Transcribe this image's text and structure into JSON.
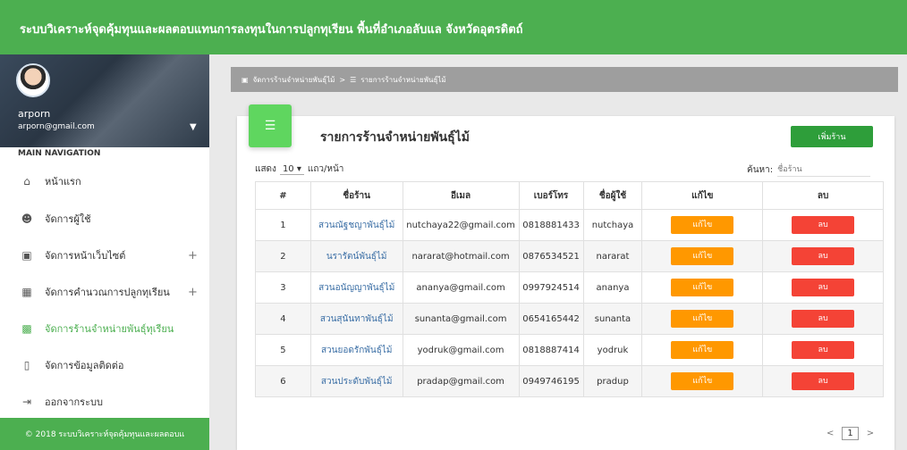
{
  "app": {
    "title": "ระบบวิเคราะห์จุดคุ้มทุนและผลตอบแทนการลงทุนในการปลูกทุเรียน พื้นที่อำเภอลับแล จังหวัดอุตรดิตถ์",
    "brand_color": "#4caf50"
  },
  "sidebar": {
    "user_name": "arporn",
    "user_email": "arporn@gmail.com",
    "nav_header": "MAIN NAVIGATION",
    "items": [
      {
        "label": "หน้าแรก",
        "icon": "home-icon"
      },
      {
        "label": "จัดการผู้ใช้",
        "icon": "user-icon"
      },
      {
        "label": "จัดการหน้าเว็บไซต์",
        "icon": "web-icon",
        "expand": "+"
      },
      {
        "label": "จัดการคำนวณการปลูกทุเรียน",
        "icon": "chart-icon",
        "expand": "+"
      },
      {
        "label": "จัดการร้านจำหน่ายพันธุ์ทุเรียน",
        "icon": "store-icon"
      },
      {
        "label": "จัดการข้อมูลติดต่อ",
        "icon": "message-icon"
      },
      {
        "label": "ออกจากระบบ",
        "icon": "logout-icon"
      }
    ],
    "footer": "© 2018 ระบบวิเคราะห์จุดคุ้มทุนและผลตอบแ"
  },
  "breadcrumb": {
    "parent": "จัดการร้านจำหน่ายพันธุ์ไม้",
    "separator": ">",
    "current": "รายการร้านจำหน่ายพันธุ์ไม้"
  },
  "card": {
    "title": "รายการร้านจำหน่ายพันธุ์ไม้",
    "add_button": "เพิ่มร้าน",
    "show_label": "แสดง",
    "show_value": "10",
    "show_suffix": "แถว/หน้า",
    "search_label": "ค้นหา:",
    "search_placeholder": "ชื่อร้าน"
  },
  "table": {
    "headers": [
      "#",
      "ชื่อร้าน",
      "อีเมล",
      "เบอร์โทร",
      "ชื่อผู้ใช้",
      "แก้ไข",
      "ลบ"
    ],
    "edit_label": "แก้ไข",
    "delete_label": "ลบ",
    "rows": [
      {
        "no": "1",
        "shop": "สวนณัฐชญาพันธุ์ไม้",
        "email": "nutchaya22@gmail.com",
        "phone": "0818881433",
        "user": "nutchaya"
      },
      {
        "no": "2",
        "shop": "นรารัตน์พันธุ์ไม้",
        "email": "nararat@hotmail.com",
        "phone": "0876534521",
        "user": "nararat"
      },
      {
        "no": "3",
        "shop": "สวนอนัญญาพันธุ์ไม้",
        "email": "ananya@gmail.com",
        "phone": "0997924514",
        "user": "ananya"
      },
      {
        "no": "4",
        "shop": "สวนสุนันทาพันธุ์ไม้",
        "email": "sunanta@gmail.com",
        "phone": "0654165442",
        "user": "sunanta"
      },
      {
        "no": "5",
        "shop": "สวนยอดรักพันธุ์ไม้",
        "email": "yodruk@gmail.com",
        "phone": "0818887414",
        "user": "yodruk"
      },
      {
        "no": "6",
        "shop": "สวนประดับพันธุ์ไม้",
        "email": "pradap@gmail.com",
        "phone": "0949746195",
        "user": "pradup"
      }
    ]
  },
  "pagination": {
    "prev": "<",
    "page": "1",
    "next": ">"
  }
}
